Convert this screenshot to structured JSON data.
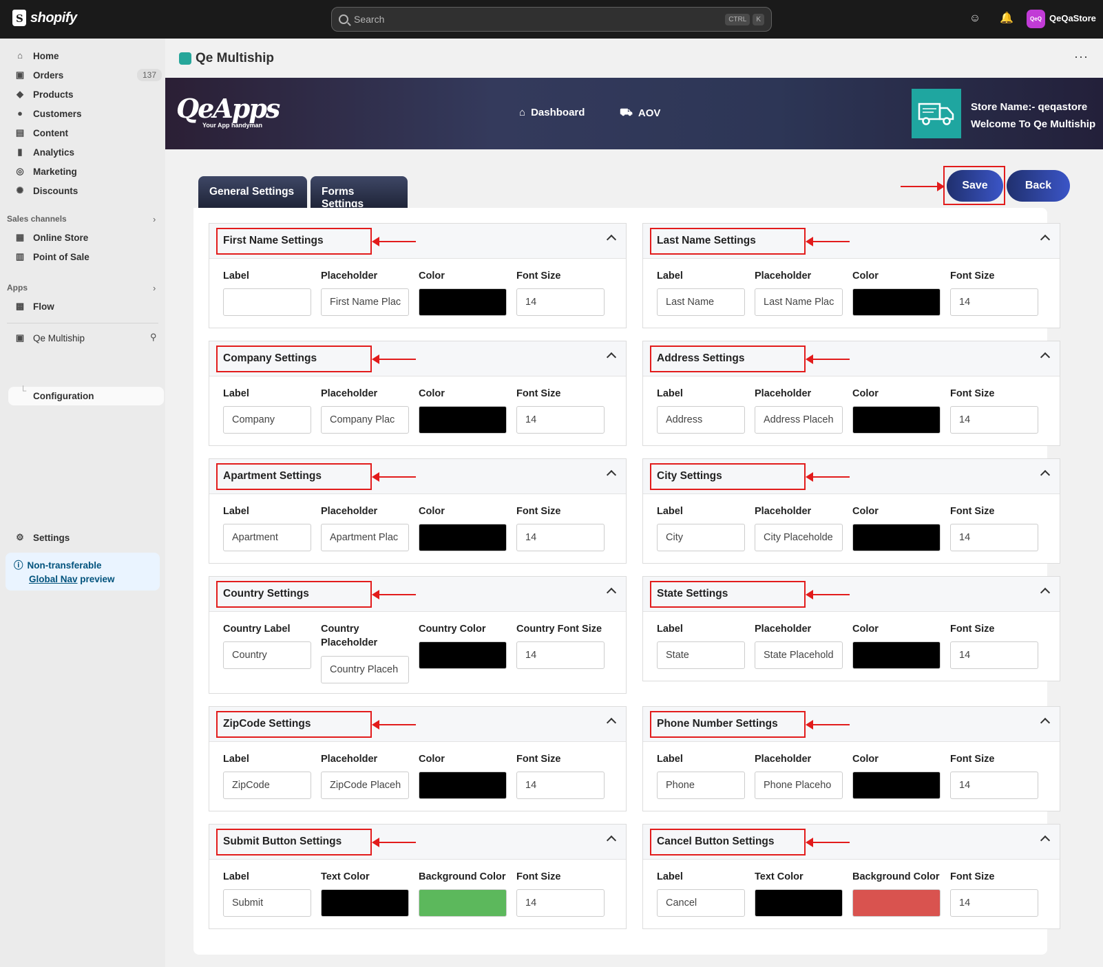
{
  "topbar": {
    "logo_text": "shopify",
    "search_placeholder": "Search",
    "shortcut_ctrl": "CTRL",
    "shortcut_k": "K",
    "store_initials": "QeQ",
    "store_name": "QeQaStore"
  },
  "sidebar": {
    "items": [
      {
        "label": "Home",
        "icon": "home-icon"
      },
      {
        "label": "Orders",
        "icon": "orders-icon",
        "badge": "137"
      },
      {
        "label": "Products",
        "icon": "tag-icon"
      },
      {
        "label": "Customers",
        "icon": "person-icon"
      },
      {
        "label": "Content",
        "icon": "content-icon"
      },
      {
        "label": "Analytics",
        "icon": "bar-chart-icon"
      },
      {
        "label": "Marketing",
        "icon": "target-icon"
      },
      {
        "label": "Discounts",
        "icon": "discount-icon"
      }
    ],
    "sales_channels_title": "Sales channels",
    "sales_channels": [
      {
        "label": "Online Store",
        "icon": "store-icon"
      },
      {
        "label": "Point of Sale",
        "icon": "pos-icon"
      }
    ],
    "apps_title": "Apps",
    "apps": [
      {
        "label": "Flow",
        "icon": "flow-icon"
      }
    ],
    "app_item": "Qe Multiship",
    "app_sub_item": "Configuration",
    "settings_label": "Settings",
    "note_line1": "Non-transferable",
    "note_link": "Global Nav",
    "note_suffix": " preview"
  },
  "page": {
    "title": "Qe Multiship",
    "more": "···"
  },
  "banner": {
    "brand": "QeApps",
    "tagline": "Your App handyman",
    "nav": [
      "Dashboard",
      "AOV"
    ],
    "store_name_line": "Store Name:-  qeqastore",
    "welcome_line": "Welcome To Qe Multiship"
  },
  "tabs": [
    "General Settings",
    "Forms Settings"
  ],
  "actions": {
    "save": "Save",
    "back": "Back"
  },
  "cards": [
    {
      "title": "First Name Settings",
      "labels": [
        "Label",
        "Placeholder",
        "Color",
        "Font Size"
      ],
      "values": [
        "",
        "First Name Plac",
        "#000000",
        "14"
      ]
    },
    {
      "title": "Last Name Settings",
      "labels": [
        "Label",
        "Placeholder",
        "Color",
        "Font Size"
      ],
      "values": [
        "Last Name",
        "Last Name Plac",
        "#000000",
        "14"
      ]
    },
    {
      "title": "Company Settings",
      "labels": [
        "Label",
        "Placeholder",
        "Color",
        "Font Size"
      ],
      "values": [
        "Company",
        "Company Plac",
        "#000000",
        "14"
      ]
    },
    {
      "title": "Address Settings",
      "labels": [
        "Label",
        "Placeholder",
        "Color",
        "Font Size"
      ],
      "values": [
        "Address",
        "Address Placeh",
        "#000000",
        "14"
      ]
    },
    {
      "title": "Apartment Settings",
      "labels": [
        "Label",
        "Placeholder",
        "Color",
        "Font Size"
      ],
      "values": [
        "Apartment",
        "Apartment Plac",
        "#000000",
        "14"
      ]
    },
    {
      "title": "City Settings",
      "labels": [
        "Label",
        "Placeholder",
        "Color",
        "Font Size"
      ],
      "values": [
        "City",
        "City Placeholde",
        "#000000",
        "14"
      ]
    },
    {
      "title": "Country Settings",
      "labels": [
        "Country Label",
        "Country Placeholder",
        "Country Color",
        "Country Font Size"
      ],
      "values": [
        "Country",
        "Country Placeh",
        "#000000",
        "14"
      ]
    },
    {
      "title": "State Settings",
      "labels": [
        "Label",
        "Placeholder",
        "Color",
        "Font Size"
      ],
      "values": [
        "State",
        "State Placehold",
        "#000000",
        "14"
      ]
    },
    {
      "title": "ZipCode Settings",
      "labels": [
        "Label",
        "Placeholder",
        "Color",
        "Font Size"
      ],
      "values": [
        "ZipCode",
        "ZipCode Placeh",
        "#000000",
        "14"
      ]
    },
    {
      "title": "Phone Number Settings",
      "labels": [
        "Label",
        "Placeholder",
        "Color",
        "Font Size"
      ],
      "values": [
        "Phone",
        "Phone Placeho",
        "#000000",
        "14"
      ]
    },
    {
      "title": "Submit Button Settings",
      "labels": [
        "Label",
        "Text Color",
        "Background Color",
        "Font Size"
      ],
      "values": [
        "Submit",
        "#000000",
        "#5cb85c",
        "14"
      ]
    },
    {
      "title": "Cancel Button Settings",
      "labels": [
        "Label",
        "Text Color",
        "Background Color",
        "Font Size"
      ],
      "values": [
        "Cancel",
        "#000000",
        "#d9534f",
        "14"
      ]
    }
  ],
  "colors": {
    "annotation_red": "#e21b1b",
    "button_blue": "#20306e"
  }
}
